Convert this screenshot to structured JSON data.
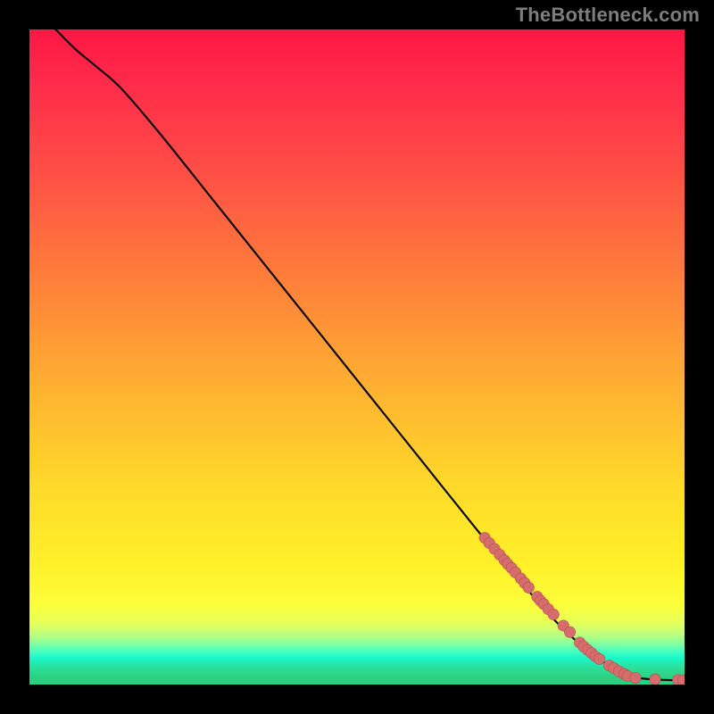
{
  "attribution": "TheBottleneck.com",
  "colors": {
    "frame_border": "#000000",
    "curve": "#000000",
    "marker_fill": "#d76c6c",
    "marker_stroke": "#af5151",
    "gradient_top": "#ff1744",
    "gradient_mid": "#ffe628",
    "gradient_bottom": "#2bd183"
  },
  "chart_data": {
    "type": "line",
    "title": "",
    "xlabel": "",
    "ylabel": "",
    "xlim": [
      0,
      100
    ],
    "ylim": [
      0,
      100
    ],
    "grid": false,
    "legend": false,
    "series": [
      {
        "name": "curve",
        "kind": "line",
        "x": [
          4,
          7,
          10,
          14,
          20,
          28,
          36,
          44,
          52,
          60,
          68,
          73,
          76,
          80,
          84,
          88,
          90,
          91.5,
          93,
          95,
          97,
          100
        ],
        "y": [
          100,
          97,
          94.5,
          91,
          84,
          74,
          64,
          54,
          44,
          34,
          24,
          18,
          14.5,
          10,
          6.2,
          3.2,
          2.0,
          1.4,
          1.0,
          0.8,
          0.7,
          0.6
        ]
      },
      {
        "name": "markers",
        "kind": "scatter",
        "x": [
          69.5,
          70.2,
          71.0,
          71.8,
          72.5,
          73.0,
          73.6,
          74.2,
          75.0,
          75.6,
          76.2,
          77.5,
          78.0,
          78.5,
          79.2,
          80.0,
          81.5,
          82.5,
          84.0,
          84.6,
          85.2,
          85.8,
          86.4,
          87.0,
          88.5,
          89.2,
          90.0,
          90.8,
          91.3,
          92.5,
          95.5,
          99.0,
          99.8
        ],
        "y": [
          22.4,
          21.6,
          20.7,
          19.8,
          19.0,
          18.4,
          17.8,
          17.1,
          16.2,
          15.5,
          14.8,
          13.4,
          12.8,
          12.3,
          11.5,
          10.7,
          9.0,
          8.0,
          6.4,
          5.8,
          5.3,
          4.8,
          4.3,
          3.9,
          2.9,
          2.5,
          2.0,
          1.6,
          1.3,
          1.0,
          0.8,
          0.7,
          0.6
        ]
      }
    ]
  }
}
